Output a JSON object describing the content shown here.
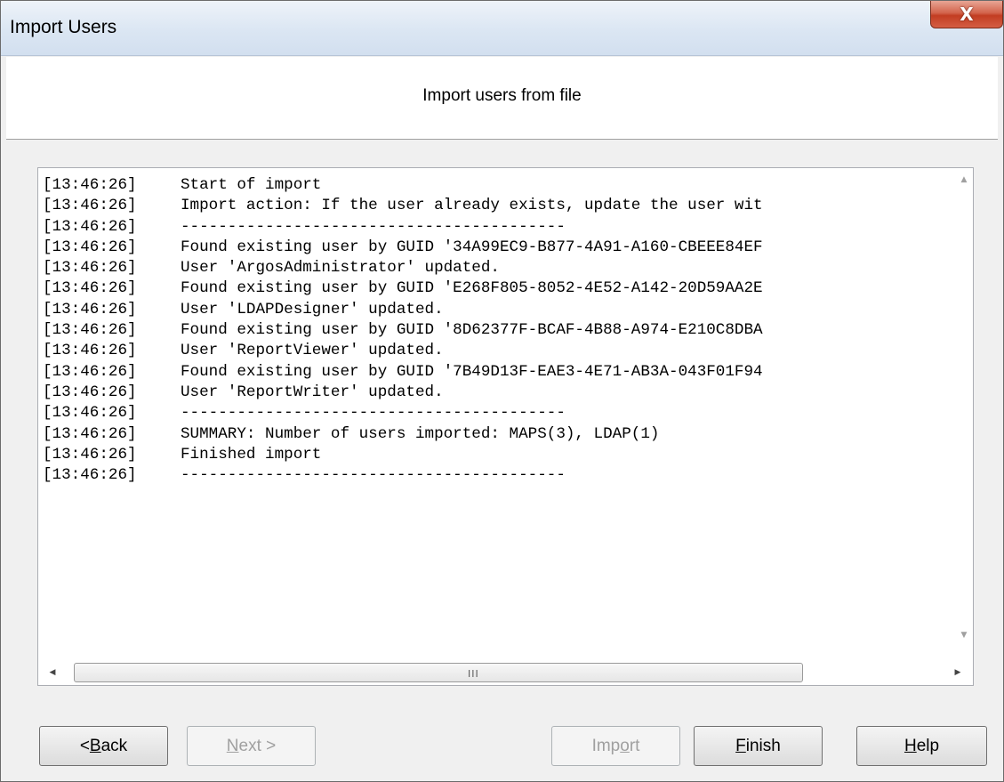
{
  "window": {
    "title": "Import Users",
    "close_glyph": "X"
  },
  "header": {
    "title": "Import users from file"
  },
  "log": {
    "lines": [
      {
        "time": "[13:46:26]",
        "message": "Start of import"
      },
      {
        "time": "[13:46:26]",
        "message": "Import action: If the user already exists, update the user wit"
      },
      {
        "time": "[13:46:26]",
        "message": "-----------------------------------------"
      },
      {
        "time": "[13:46:26]",
        "message": "Found existing user by GUID '34A99EC9-B877-4A91-A160-CBEEE84EF"
      },
      {
        "time": "[13:46:26]",
        "message": "User 'ArgosAdministrator' updated."
      },
      {
        "time": "[13:46:26]",
        "message": "Found existing user by GUID 'E268F805-8052-4E52-A142-20D59AA2E"
      },
      {
        "time": "[13:46:26]",
        "message": "User 'LDAPDesigner' updated."
      },
      {
        "time": "[13:46:26]",
        "message": "Found existing user by GUID '8D62377F-BCAF-4B88-A974-E210C8DBA"
      },
      {
        "time": "[13:46:26]",
        "message": "User 'ReportViewer' updated."
      },
      {
        "time": "[13:46:26]",
        "message": "Found existing user by GUID '7B49D13F-EAE3-4E71-AB3A-043F01F94"
      },
      {
        "time": "[13:46:26]",
        "message": "User 'ReportWriter' updated."
      },
      {
        "time": "[13:46:26]",
        "message": "-----------------------------------------"
      },
      {
        "time": "[13:46:26]",
        "message": "SUMMARY: Number of users imported: MAPS(3), LDAP(1)"
      },
      {
        "time": "[13:46:26]",
        "message": "Finished import"
      },
      {
        "time": "[13:46:26]",
        "message": "-----------------------------------------"
      }
    ],
    "hscroll_grip": "III"
  },
  "buttons": {
    "back": {
      "pre": "< ",
      "accel": "B",
      "post": "ack"
    },
    "next": {
      "pre": "",
      "accel": "N",
      "post": "ext >"
    },
    "import": {
      "pre": "Imp",
      "accel": "o",
      "post": "rt"
    },
    "finish": {
      "pre": "",
      "accel": "F",
      "post": "inish"
    },
    "help": {
      "pre": "",
      "accel": "H",
      "post": "elp"
    }
  }
}
